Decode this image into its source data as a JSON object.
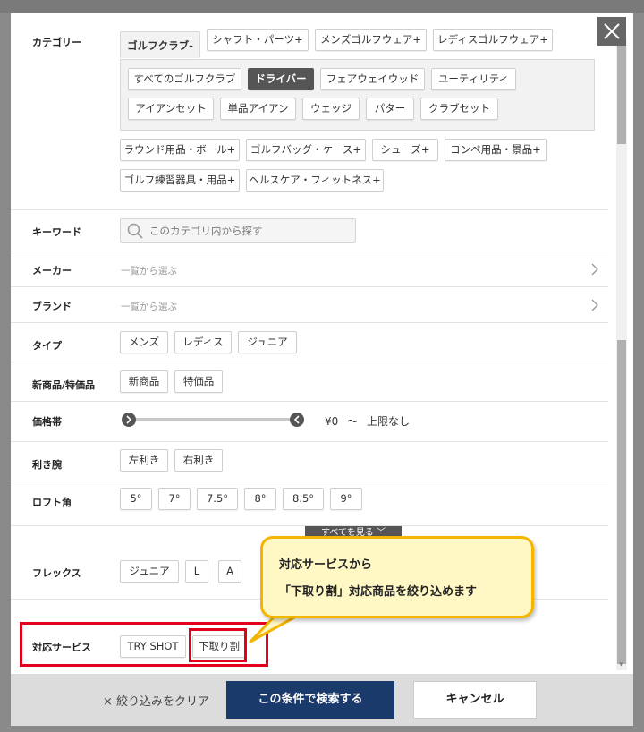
{
  "filters": {
    "category": {
      "label": "カテゴリー",
      "top_tabs": [
        "ゴルフクラブ-",
        "シャフト・パーツ+",
        "メンズゴルフウェア+",
        "レディスゴルフウェア+"
      ],
      "sub_items": [
        "すべてのゴルフクラブ",
        "ドライバー",
        "フェアウェイウッド",
        "ユーティリティ",
        "アイアンセット",
        "単品アイアン",
        "ウェッジ",
        "パター",
        "クラブセット"
      ],
      "selected_sub": "ドライバー",
      "more_tabs": [
        "ラウンド用品・ボール+",
        "ゴルフバッグ・ケース+",
        "シューズ+",
        "コンペ用品・景品+",
        "ゴルフ練習器具・用品+",
        "ヘルスケア・フィットネス+"
      ]
    },
    "keyword": {
      "label": "キーワード",
      "placeholder": "このカテゴリ内から探す"
    },
    "maker": {
      "label": "メーカー",
      "value": "一覧から選ぶ"
    },
    "brand": {
      "label": "ブランド",
      "value": "一覧から選ぶ"
    },
    "type": {
      "label": "タイプ",
      "options": [
        "メンズ",
        "レディス",
        "ジュニア"
      ]
    },
    "new_sale": {
      "label": "新商品/特価品",
      "options": [
        "新商品",
        "特価品"
      ]
    },
    "price": {
      "label": "価格帯",
      "min_text": "¥0",
      "separator": "～",
      "max_text": "上限なし"
    },
    "hand": {
      "label": "利き腕",
      "options": [
        "左利き",
        "右利き"
      ]
    },
    "loft": {
      "label": "ロフト角",
      "options": [
        "5°",
        "7°",
        "7.5°",
        "8°",
        "8.5°",
        "9°"
      ]
    },
    "see_all": "すべてを見る ﹀",
    "flex": {
      "label": "フレックス",
      "options": [
        "ジュニア",
        "L",
        "A"
      ]
    },
    "service": {
      "label": "対応サービス",
      "options": [
        "TRY SHOT",
        "下取り割"
      ]
    }
  },
  "callout": {
    "line1": "対応サービスから",
    "line2": "「下取り割」対応商品を絞り込めます"
  },
  "footer": {
    "clear_label": "× 絞り込みをクリア",
    "search_label": "この条件で検索する",
    "cancel_label": "キャンセル"
  },
  "colors": {
    "primary": "#1a3a6c",
    "selected_chip": "#555555",
    "highlight_red": "#e2001a",
    "callout_fill": "#fff8c5",
    "callout_border": "#f5b400"
  },
  "icons": [
    "search-icon",
    "chevron-right-icon",
    "close-icon",
    "slider-arrow-icon"
  ]
}
